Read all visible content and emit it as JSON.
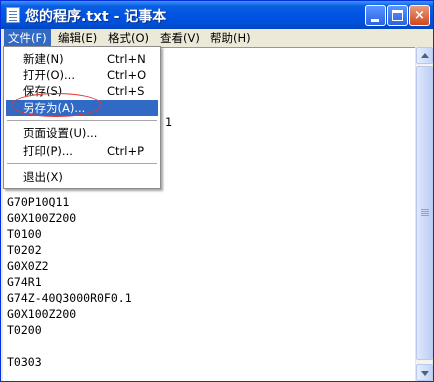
{
  "window": {
    "title": "您的程序.txt - 记事本",
    "controls": {
      "minimize": "_",
      "maximize": "□",
      "close": "×"
    }
  },
  "menubar": {
    "items": [
      {
        "label": "文件(F)",
        "active": true
      },
      {
        "label": "编辑(E)"
      },
      {
        "label": "格式(O)"
      },
      {
        "label": "查看(V)"
      },
      {
        "label": "帮助(H)"
      }
    ]
  },
  "file_menu": {
    "items": [
      {
        "label": "新建(N)",
        "shortcut": "Ctrl+N"
      },
      {
        "label": "打开(O)...",
        "shortcut": "Ctrl+O"
      },
      {
        "label": "保存(S)",
        "shortcut": "Ctrl+S"
      },
      {
        "label": "另存为(A)...",
        "shortcut": "",
        "highlighted": true
      },
      {
        "label": "页面设置(U)...",
        "shortcut": ""
      },
      {
        "label": "打印(P)...",
        "shortcut": "Ctrl+P"
      },
      {
        "label": "退出(X)",
        "shortcut": ""
      }
    ]
  },
  "editor": {
    "partial_line": "1",
    "lines": [
      "G70P10Q11",
      "G0X100Z200",
      "T0100",
      "T0202",
      "G0X0Z2",
      "G74R1",
      "G74Z-40Q3000R0F0.1",
      "G0X100Z200",
      "T0200",
      "",
      "T0303"
    ]
  },
  "colors": {
    "titlebar": "#0054e3",
    "highlight": "#316ac5",
    "annotation": "#e0383a"
  }
}
